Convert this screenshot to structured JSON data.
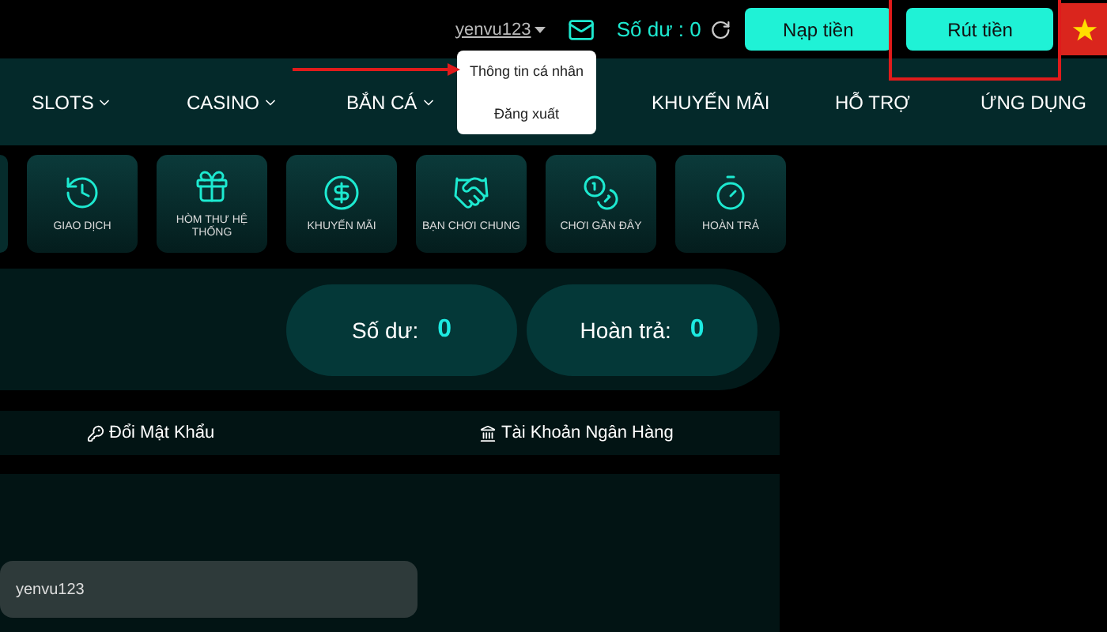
{
  "top_bar": {
    "username": "yenvu123",
    "balance_label": "Số dư : 0",
    "buttons": [
      {
        "label": "Nạp tiền",
        "highlighted": false
      },
      {
        "label": "Rút tiền",
        "highlighted": true
      }
    ]
  },
  "user_menu": {
    "expanded": true,
    "items": [
      {
        "label": "Thông tin cá nhân",
        "pointed": true
      },
      {
        "label": "Đăng xuất",
        "pointed": false
      }
    ]
  },
  "nav": [
    {
      "label": "SLOTS",
      "dropdown": true
    },
    {
      "label": "CASINO",
      "dropdown": true
    },
    {
      "label": "BẮN CÁ",
      "dropdown": true
    },
    {
      "label": "KHUYẾN MÃI",
      "dropdown": false
    },
    {
      "label": "HỖ TRỢ",
      "dropdown": false
    },
    {
      "label": "ỨNG DỤNG",
      "dropdown": false
    }
  ],
  "shortcuts": [
    {
      "label": "GIAO DỊCH",
      "kind": "history"
    },
    {
      "label": "HÒM THƯ HỆ THỐNG",
      "kind": "gift"
    },
    {
      "label": "KHUYẾN MÃI",
      "kind": "promo"
    },
    {
      "label": "BẠN CHƠI CHUNG",
      "kind": "friends"
    },
    {
      "label": "CHƠI GẦN ĐÂY",
      "kind": "chip"
    },
    {
      "label": "HOÀN TRẢ",
      "kind": "timer"
    }
  ],
  "balances": [
    {
      "label": "Số dư:",
      "value": "0"
    },
    {
      "label": "Hoàn trả:",
      "value": "0"
    }
  ],
  "account_tabs": [
    {
      "label": "Đổi Mật Khẩu",
      "kind": "password"
    },
    {
      "label": "Tài Khoản Ngân Hàng",
      "kind": "bank"
    }
  ],
  "username_field": {
    "value": "yenvu123"
  }
}
